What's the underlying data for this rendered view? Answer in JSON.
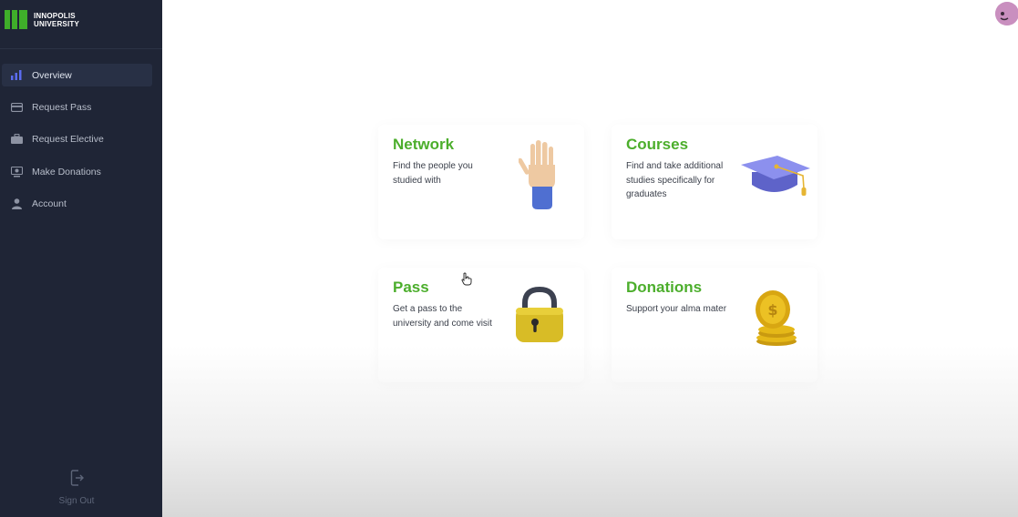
{
  "brand": {
    "line1": "INNOPOLIS",
    "line2": "UNIVERSITY",
    "color": "#3fae2a"
  },
  "sidebar": {
    "items": [
      {
        "label": "Overview",
        "icon": "bar-chart-icon",
        "active": true
      },
      {
        "label": "Request Pass",
        "icon": "card-icon"
      },
      {
        "label": "Request Elective",
        "icon": "briefcase-icon"
      },
      {
        "label": "Make Donations",
        "icon": "donation-icon"
      },
      {
        "label": "Account",
        "icon": "user-icon"
      }
    ],
    "signout_label": "Sign Out"
  },
  "cards": [
    {
      "title": "Network",
      "description": "Find the people you studied with",
      "icon": "hand-icon"
    },
    {
      "title": "Courses",
      "description": "Find and take additional studies specifically for graduates",
      "icon": "graduation-cap-icon"
    },
    {
      "title": "Pass",
      "description": "Get a pass to the university and come visit",
      "icon": "padlock-icon"
    },
    {
      "title": "Donations",
      "description": "Support your alma mater",
      "icon": "coins-icon"
    }
  ],
  "colors": {
    "accent": "#4cae2c",
    "sidebar_bg": "#1f2536",
    "active_icon": "#5b6cf0"
  }
}
